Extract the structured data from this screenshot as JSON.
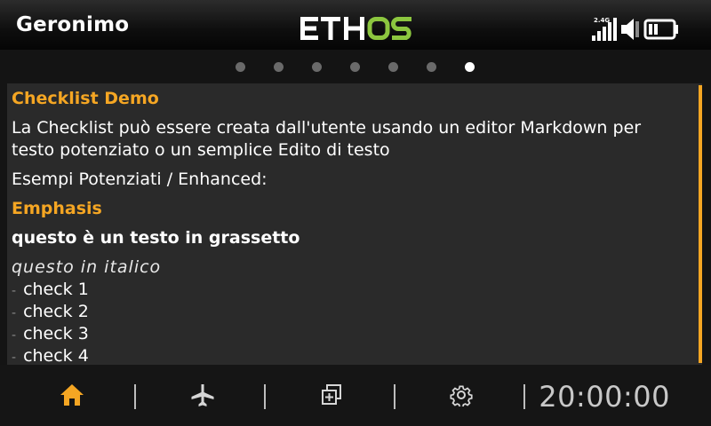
{
  "header": {
    "model_name": "Geronimo",
    "brand": "ETHOS",
    "brand_colors": {
      "eth": "#ffffff",
      "os": "#8cc63f"
    },
    "radio_band": "2.4G",
    "icons": [
      "signal-bars-icon",
      "speaker-muted-icon",
      "battery-icon"
    ]
  },
  "pager": {
    "total_pages": 7,
    "active_page": 7
  },
  "checklist": {
    "title": "Checklist Demo",
    "intro": "La Checklist può essere creata dall'utente usando un editor Markdown per",
    "intro_cont": "testo potenziato o un semplice Edito di testo",
    "examples_label": "Esempi Potenziati / Enhanced:",
    "emphasis_heading": "Emphasis",
    "bold_text": "questo è un testo in grassetto",
    "italic_text": "questo in italico",
    "bullet_mark": "-",
    "items": [
      "check 1",
      "check 2",
      "check 3",
      "check 4"
    ]
  },
  "footer": {
    "nav": [
      "home-icon",
      "airplane-icon",
      "model-setup-icon",
      "settings-icon"
    ],
    "active_color": "#f5a623",
    "clock": "20:00:00"
  }
}
